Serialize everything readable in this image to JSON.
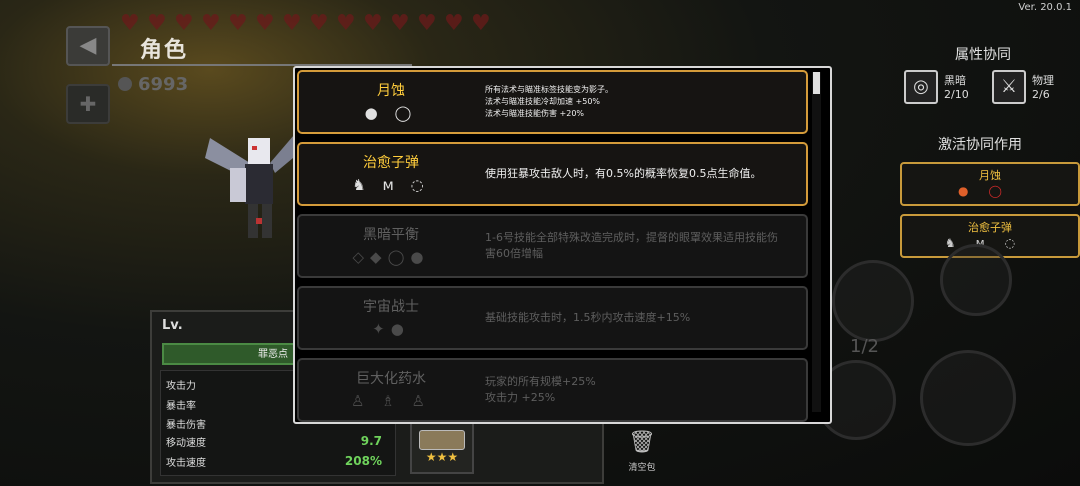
{
  "version": "Ver. 20.0.1",
  "header": {
    "title": "角色",
    "coins": "6993"
  },
  "stats": {
    "lv_label": "Lv.",
    "xp_label": "罪恶点",
    "rows": [
      {
        "label": "攻击力",
        "value": ""
      },
      {
        "label": "暴击率",
        "value": ""
      },
      {
        "label": "暴击伤害",
        "value": ""
      },
      {
        "label": "移动速度",
        "value": "9.7"
      },
      {
        "label": "攻击速度",
        "value": "208%"
      }
    ]
  },
  "trash_label": "清空包",
  "right_panel": {
    "attr_title": "属性协同",
    "attrs": [
      {
        "name": "黑暗",
        "count": "2/10",
        "icon": "dark-swirl-icon"
      },
      {
        "name": "物理",
        "count": "2/6",
        "icon": "sword-icon"
      }
    ],
    "activate_title": "激活协同作用",
    "active": [
      {
        "name": "月蚀",
        "icons": [
          "fireball-icon",
          "ring-icon"
        ]
      },
      {
        "name": "治愈子弹",
        "icons": [
          "boot-icon",
          "bat-icon",
          "rope-icon"
        ]
      }
    ],
    "page": "1/2"
  },
  "synergies": [
    {
      "name": "月蚀",
      "active": true,
      "size": "small",
      "desc": [
        "所有法术与瞄准标签技能变为影子。",
        "法术与瞄准技能冷却加速 +50%",
        "法术与瞄准技能伤害 +20%"
      ],
      "icons": [
        "fireball-icon",
        "ring-icon"
      ],
      "glyphs": "● ◯"
    },
    {
      "name": "治愈子弹",
      "active": true,
      "size": "mid",
      "desc": [
        "使用狂暴攻击敌人时，有0.5%的概率恢复0.5点生命值。"
      ],
      "icons": [
        "boot-icon",
        "bat-icon",
        "rope-icon"
      ],
      "glyphs": "♞ ᴍ ◌"
    },
    {
      "name": "黑暗平衡",
      "active": false,
      "size": "mid",
      "desc": [
        "1-6号技能全部特殊改造完成时，提督的眼罩效果适用技能伤",
        "害60倍增幅"
      ],
      "icons": [
        "wing-icon",
        "gem-icon",
        "ring-icon",
        "orb-icon"
      ],
      "glyphs": "◇◆◯●"
    },
    {
      "name": "宇宙战士",
      "active": false,
      "size": "mid",
      "desc": [
        "基础技能攻击时，1.5秒内攻击速度+15%"
      ],
      "icons": [
        "demon-icon",
        "orb-icon"
      ],
      "glyphs": "✦●"
    },
    {
      "name": "巨大化药水",
      "active": false,
      "size": "mid",
      "desc": [
        "玩家的所有规模+25%",
        "攻击力 +25%"
      ],
      "icons": [
        "potion-icon",
        "potion-icon",
        "potion-icon"
      ],
      "glyphs": "♙ ♗ ♙"
    }
  ],
  "colors": {
    "gold": "#d49b3a",
    "green": "#6fd35c"
  }
}
